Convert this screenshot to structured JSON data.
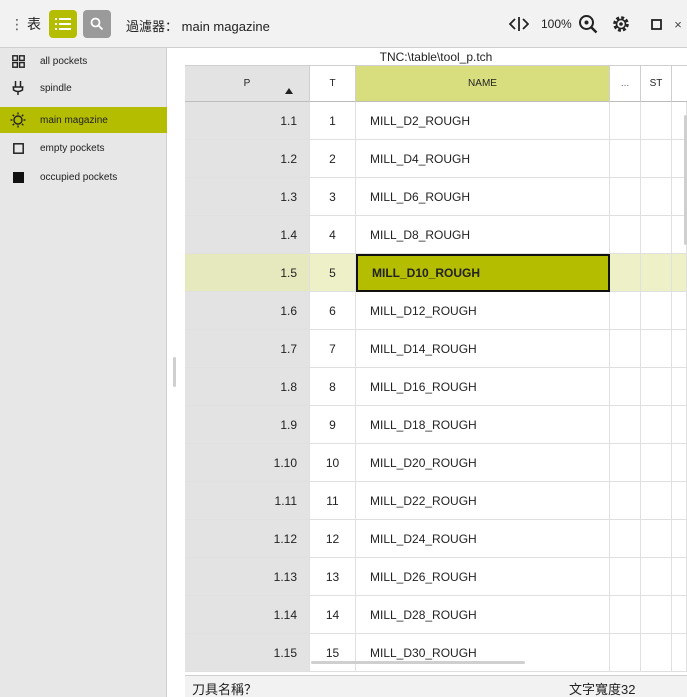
{
  "toolbar": {
    "mode_label": "表",
    "filter_label": "過濾器：",
    "filter_value": "main magazine",
    "zoom": "100%"
  },
  "sidebar": {
    "items": [
      {
        "label": "all pockets",
        "icon": "grid-icon"
      },
      {
        "label": "spindle",
        "icon": "spindle-icon"
      },
      {
        "label": "main magazine",
        "icon": "magazine-icon"
      },
      {
        "label": "empty pockets",
        "icon": "empty-square-icon"
      },
      {
        "label": "occupied pockets",
        "icon": "filled-square-icon"
      }
    ]
  },
  "table": {
    "path": "TNC:\\table\\tool_p.tch",
    "columns": [
      "P",
      "T",
      "NAME",
      "...",
      "ST"
    ],
    "selected_row": 4,
    "rows": [
      {
        "p": "1.1",
        "t": "1",
        "name": "MILL_D2_ROUGH"
      },
      {
        "p": "1.2",
        "t": "2",
        "name": "MILL_D4_ROUGH"
      },
      {
        "p": "1.3",
        "t": "3",
        "name": "MILL_D6_ROUGH"
      },
      {
        "p": "1.4",
        "t": "4",
        "name": "MILL_D8_ROUGH"
      },
      {
        "p": "1.5",
        "t": "5",
        "name": "MILL_D10_ROUGH"
      },
      {
        "p": "1.6",
        "t": "6",
        "name": "MILL_D12_ROUGH"
      },
      {
        "p": "1.7",
        "t": "7",
        "name": "MILL_D14_ROUGH"
      },
      {
        "p": "1.8",
        "t": "8",
        "name": "MILL_D16_ROUGH"
      },
      {
        "p": "1.9",
        "t": "9",
        "name": "MILL_D18_ROUGH"
      },
      {
        "p": "1.10",
        "t": "10",
        "name": "MILL_D20_ROUGH"
      },
      {
        "p": "1.11",
        "t": "11",
        "name": "MILL_D22_ROUGH"
      },
      {
        "p": "1.12",
        "t": "12",
        "name": "MILL_D24_ROUGH"
      },
      {
        "p": "1.13",
        "t": "13",
        "name": "MILL_D26_ROUGH"
      },
      {
        "p": "1.14",
        "t": "14",
        "name": "MILL_D28_ROUGH"
      },
      {
        "p": "1.15",
        "t": "15",
        "name": "MILL_D30_ROUGH"
      }
    ]
  },
  "footer": {
    "field_label": "刀具名稱？",
    "text_width": "文字寬度32"
  },
  "colors": {
    "accent": "#b4bd00",
    "header_accent": "#d8de7e",
    "selected_row": "#eef0c8"
  }
}
